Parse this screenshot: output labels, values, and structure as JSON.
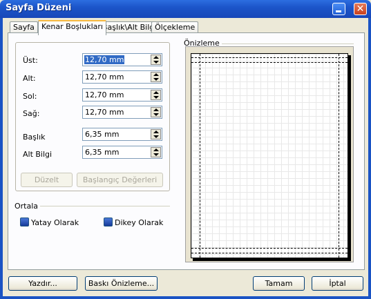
{
  "window": {
    "title": "Sayfa Düzeni"
  },
  "tabs": [
    {
      "label": "Sayfa"
    },
    {
      "label": "Kenar Boşlukları"
    },
    {
      "label": "Başlık\\Alt Bilgi"
    },
    {
      "label": "Ölçekleme"
    }
  ],
  "margins": {
    "fields": [
      {
        "label": "Üst:",
        "value": "12,70 mm"
      },
      {
        "label": "Alt:",
        "value": "12,70 mm"
      },
      {
        "label": "Sol:",
        "value": "12,70 mm"
      },
      {
        "label": "Sağ:",
        "value": "12,70 mm"
      },
      {
        "label": "Başlık",
        "value": "6,35 mm"
      },
      {
        "label": "Alt Bilgi",
        "value": "6,35 mm"
      }
    ],
    "fix_button": "Düzelt",
    "reset_button": "Başlangıç Değerleri"
  },
  "center": {
    "title": "Ortala",
    "horizontal": "Yatay Olarak",
    "vertical": "Dikey Olarak"
  },
  "preview": {
    "title": "Önizleme"
  },
  "footer": {
    "print": "Yazdır...",
    "print_preview": "Baskı Önizleme...",
    "ok": "Tamam",
    "cancel": "İptal"
  }
}
